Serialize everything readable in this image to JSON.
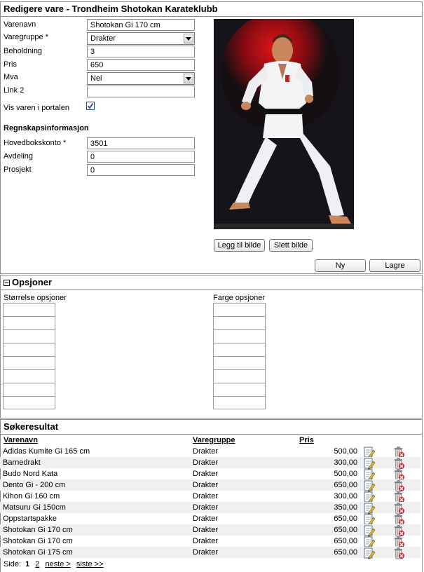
{
  "edit": {
    "title": "Redigere vare - Trondheim Shotokan Karateklubb",
    "fields": {
      "name_label": "Varenavn",
      "name_value": "Shotokan Gi 170 cm",
      "group_label": "Varegruppe *",
      "group_value": "Drakter",
      "stock_label": "Beholdning",
      "stock_value": "3",
      "price_label": "Pris",
      "price_value": "650",
      "vat_label": "Mva",
      "vat_value": "Nei",
      "link_label": "Link 2",
      "link_value": "",
      "show_label": "Vis varen i portalen",
      "show_checked": true
    },
    "accounting": {
      "heading": "Regnskapsinformasjon",
      "account_label": "Hovedbokskonto *",
      "account_value": "3501",
      "dept_label": "Avdeling",
      "dept_value": "0",
      "project_label": "Prosjekt",
      "project_value": "0"
    },
    "add_image_label": "Legg til bilde",
    "delete_image_label": "Slett bilde",
    "new_label": "Ny",
    "save_label": "Lagre"
  },
  "options": {
    "title": "Opsjoner",
    "size_label": "Størrelse opsjoner",
    "color_label": "Farge opsjoner"
  },
  "results": {
    "title": "Søkeresultat",
    "columns": {
      "name": "Varenavn",
      "group": "Varegruppe",
      "price": "Pris"
    },
    "rows": [
      {
        "name": "Adidas Kumite Gi 165 cm",
        "group": "Drakter",
        "price": "500,00"
      },
      {
        "name": "Barnedrakt",
        "group": "Drakter",
        "price": "300,00"
      },
      {
        "name": "Budo Nord Kata",
        "group": "Drakter",
        "price": "500,00"
      },
      {
        "name": "Dento Gi - 200 cm",
        "group": "Drakter",
        "price": "650,00"
      },
      {
        "name": "Kihon Gi 160 cm",
        "group": "Drakter",
        "price": "300,00"
      },
      {
        "name": "Matsuru Gi 150cm",
        "group": "Drakter",
        "price": "350,00"
      },
      {
        "name": "Oppstartspakke",
        "group": "Drakter",
        "price": "650,00"
      },
      {
        "name": "Shotokan Gi 170 cm",
        "group": "Drakter",
        "price": "650,00"
      },
      {
        "name": "Shotokan Gi 170 cm",
        "group": "Drakter",
        "price": "650,00"
      },
      {
        "name": "Shotokan Gi 175 cm",
        "group": "Drakter",
        "price": "650,00"
      }
    ],
    "pager": {
      "label": "Side:",
      "current": "1",
      "page2": "2",
      "next": "neste >",
      "last": "siste >>"
    }
  },
  "icons": {
    "edit": "edit-icon",
    "delete": "trash-delete-icon",
    "collapse": "collapse-minus-icon"
  }
}
